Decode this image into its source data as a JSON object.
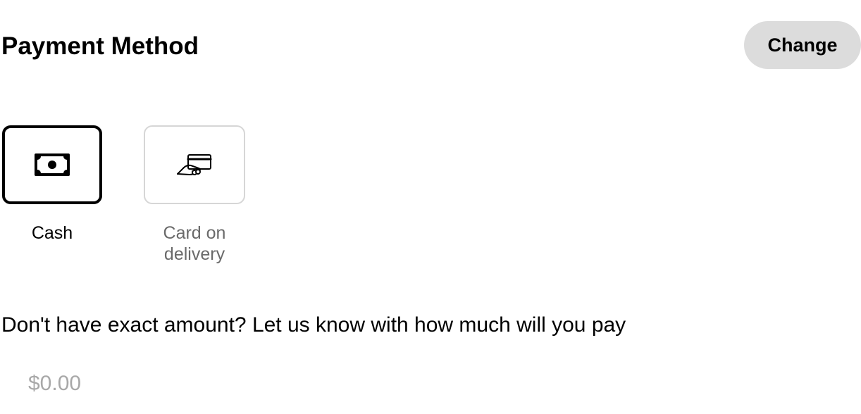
{
  "header": {
    "title": "Payment Method",
    "change_label": "Change"
  },
  "payment_options": [
    {
      "label": "Cash",
      "icon": "cash-icon",
      "selected": true
    },
    {
      "label": "Card on delivery",
      "icon": "card-hand-icon",
      "selected": false
    }
  ],
  "change_prompt": {
    "text": "Don't have exact amount? Let us know with how much will you pay",
    "amount_value": "",
    "amount_placeholder": "$0.00"
  },
  "colors": {
    "selected_border": "#000000",
    "unselected_border": "#d6d6d6",
    "button_background": "#dcdcdc",
    "muted_text": "#6a6a6a",
    "placeholder_text": "#a8a8a8"
  }
}
